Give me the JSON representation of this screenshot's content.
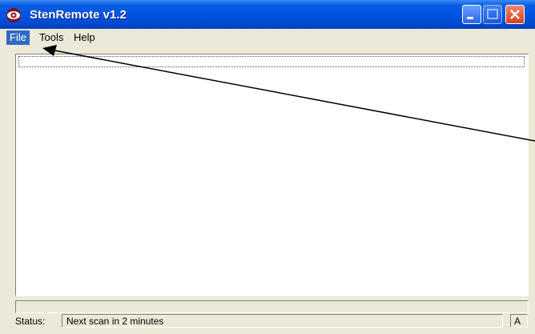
{
  "window": {
    "title": "StenRemote v1.2",
    "icon": "app-eye-icon"
  },
  "title_buttons": {
    "minimize": "minimize-icon",
    "maximize": "maximize-icon",
    "close": "close-icon"
  },
  "menu": {
    "items": [
      {
        "label": "File"
      },
      {
        "label": "Tools"
      },
      {
        "label": "Help"
      }
    ]
  },
  "status": {
    "label": "Status:",
    "message": "Next scan in 2 minutes",
    "indicator": "A"
  },
  "colors": {
    "titlebar": "#0054e3",
    "menu_highlight": "#316ac5",
    "face": "#ece9d8",
    "close_button": "#d4421d"
  }
}
